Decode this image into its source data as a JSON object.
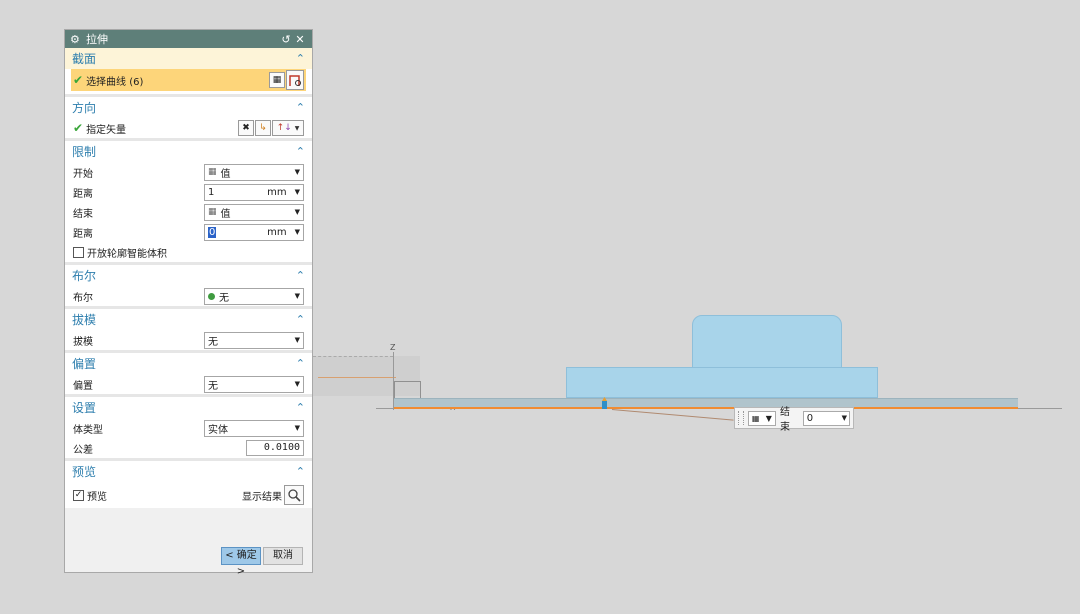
{
  "dialog": {
    "title": "拉伸",
    "sections": {
      "section": {
        "header": "截面",
        "select_curve_label": "选择曲线 (6)"
      },
      "direction": {
        "header": "方向",
        "vector_label": "指定矢量"
      },
      "limits": {
        "header": "限制",
        "start_label": "开始",
        "start_value": "值",
        "distance1_label": "距离",
        "distance1_value": "1",
        "distance1_unit": "mm",
        "end_label": "结束",
        "end_value": "值",
        "distance2_label": "距离",
        "distance2_value": "0",
        "distance2_unit": "mm",
        "open_profile_label": "开放轮廓智能体积"
      },
      "boolean": {
        "header": "布尔",
        "label": "布尔",
        "value": "无"
      },
      "draft": {
        "header": "拔模",
        "label": "拔模",
        "value": "无"
      },
      "offset": {
        "header": "偏置",
        "label": "偏置",
        "value": "无"
      },
      "settings": {
        "header": "设置",
        "body_type_label": "体类型",
        "body_type_value": "实体",
        "tolerance_label": "公差",
        "tolerance_value": "0.0100"
      },
      "preview": {
        "header": "预览",
        "preview_label": "预览",
        "show_result_label": "显示结果"
      }
    },
    "buttons": {
      "ok": "< 确定 >",
      "cancel": "取消"
    }
  },
  "viewport": {
    "axis_z": "Z",
    "axis_x": "X",
    "float_panel": {
      "label": "结束",
      "value": "0"
    }
  },
  "colors": {
    "title_bar": "#5e7f79",
    "section_header_text": "#2f7fae",
    "selection_highlight": "#fdd57a",
    "model_body": "#a8d4ea",
    "edge_highlight": "#f08c32",
    "ok_button": "#9ec8e8"
  }
}
